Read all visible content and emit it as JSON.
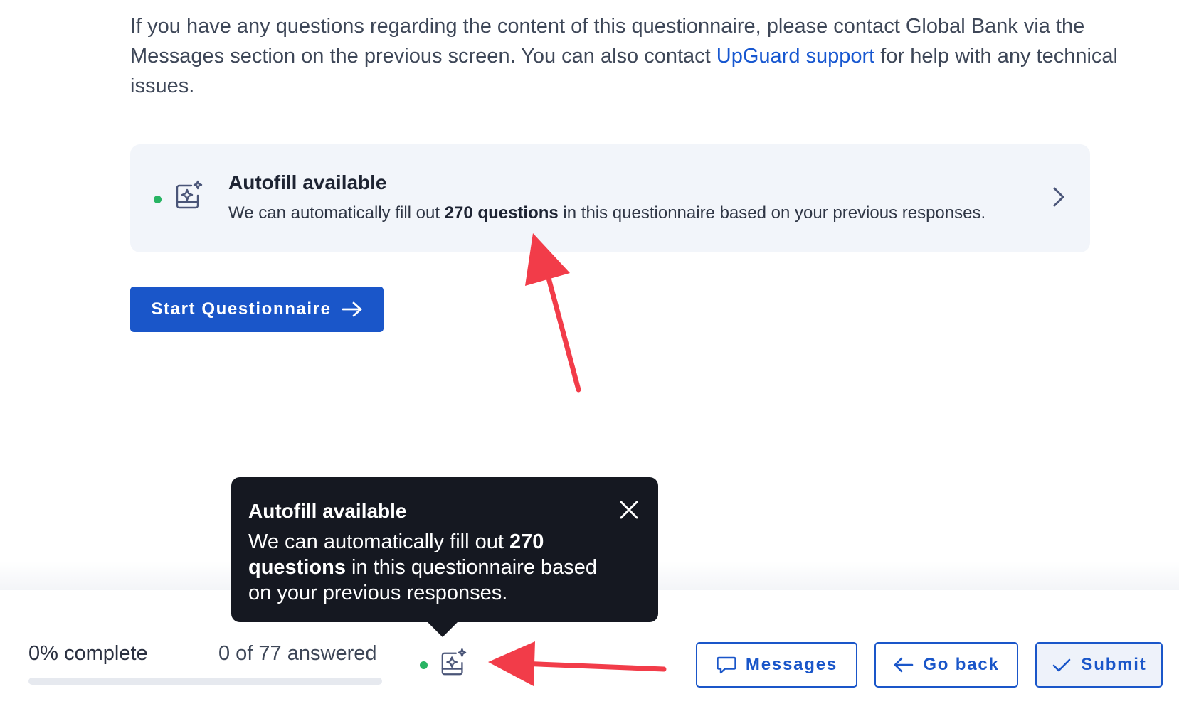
{
  "intro": {
    "text_before_link": "If you have any questions regarding the content of this questionnaire, please contact Global Bank via the Messages section on the previous screen. You can also contact ",
    "link_label": "UpGuard support",
    "text_after_link": " for help with any technical issues."
  },
  "autofill_card": {
    "title": "Autofill available",
    "desc_before": "We can automatically fill out ",
    "desc_bold": "270 questions",
    "desc_after": " in this questionnaire based on your previous responses.",
    "icon": "autofill-sparkle-icon",
    "status_color": "#28b463"
  },
  "start_button": {
    "label": "Start Questionnaire"
  },
  "tooltip": {
    "title": "Autofill available",
    "body_before": "We can automatically fill out ",
    "body_bold": "270 questions",
    "body_after": " in this questionnaire based on your previous responses."
  },
  "footer": {
    "progress_label": "0% complete",
    "progress_fraction": 0,
    "answered_label": "0 of 77 answered",
    "messages_label": "Messages",
    "go_back_label": "Go back",
    "submit_label": "Submit"
  },
  "colors": {
    "accent": "#1a56c9",
    "link": "#1757d0",
    "annotation_arrow": "#f23c49",
    "tooltip_bg": "#151821"
  }
}
